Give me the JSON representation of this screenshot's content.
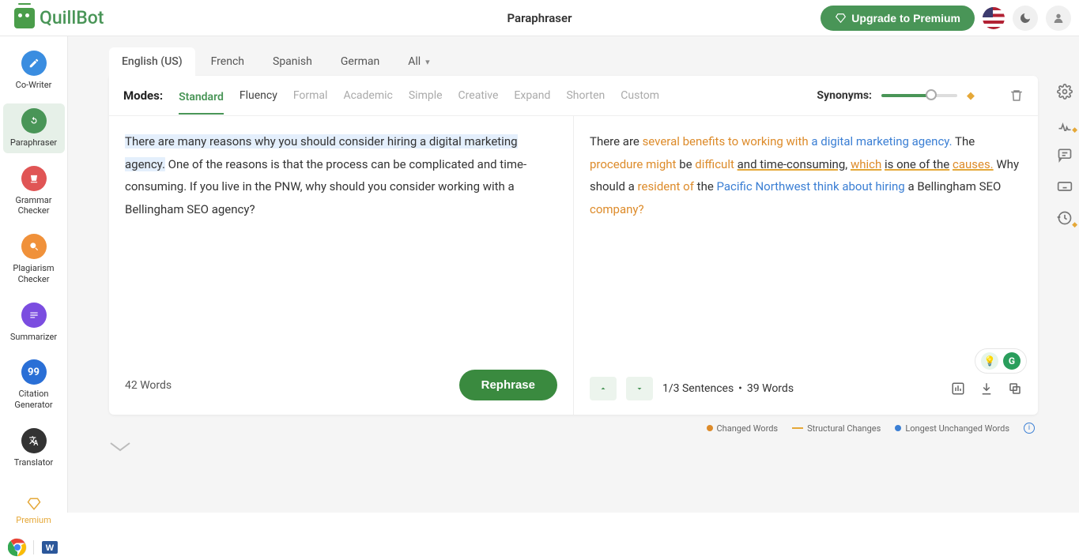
{
  "brand": "QuillBot",
  "header": {
    "title": "Paraphraser",
    "premium_button": "Upgrade to Premium"
  },
  "sidebar": {
    "items": [
      {
        "label": "Co-Writer",
        "icon": "pen-icon",
        "color": "#3a8de0"
      },
      {
        "label": "Paraphraser",
        "icon": "paraphraser-icon",
        "color": "#499557"
      },
      {
        "label": "Grammar Checker",
        "icon": "grammar-icon",
        "color": "#e05555"
      },
      {
        "label": "Plagiarism Checker",
        "icon": "plagiarism-icon",
        "color": "#f0913a"
      },
      {
        "label": "Summarizer",
        "icon": "summarizer-icon",
        "color": "#7b4de0"
      },
      {
        "label": "Citation Generator",
        "icon": "citation-icon",
        "color": "#2a6fd6"
      },
      {
        "label": "Translator",
        "icon": "translator-icon",
        "color": "#333333"
      }
    ],
    "premium_label": "Premium"
  },
  "languages": {
    "items": [
      "English (US)",
      "French",
      "Spanish",
      "German",
      "All"
    ],
    "active": "English (US)"
  },
  "modes": {
    "label": "Modes:",
    "items": [
      {
        "name": "Standard",
        "available": true,
        "selected": true
      },
      {
        "name": "Fluency",
        "available": true,
        "selected": false
      },
      {
        "name": "Formal",
        "available": false,
        "selected": false
      },
      {
        "name": "Academic",
        "available": false,
        "selected": false
      },
      {
        "name": "Simple",
        "available": false,
        "selected": false
      },
      {
        "name": "Creative",
        "available": false,
        "selected": false
      },
      {
        "name": "Expand",
        "available": false,
        "selected": false
      },
      {
        "name": "Shorten",
        "available": false,
        "selected": false
      },
      {
        "name": "Custom",
        "available": false,
        "selected": false
      }
    ],
    "synonyms_label": "Synonyms:"
  },
  "input": {
    "highlighted": "There are many reasons why you should consider hiring a digital marketing agency.",
    "rest": " One of the reasons is that the process can be complicated and time-consuming. If you live in the PNW, why should you consider working with a Bellingham SEO agency?",
    "word_count": "42 Words",
    "rephrase_button": "Rephrase"
  },
  "output": {
    "segments": [
      {
        "t": "There are ",
        "c": ""
      },
      {
        "t": "several benefits to working with",
        "c": "o"
      },
      {
        "t": " ",
        "c": ""
      },
      {
        "t": "a digital marketing agency.",
        "c": "b"
      },
      {
        "t": " The ",
        "c": ""
      },
      {
        "t": "procedure might",
        "c": "o"
      },
      {
        "t": " be ",
        "c": ""
      },
      {
        "t": "difficult",
        "c": "o"
      },
      {
        "t": " ",
        "c": ""
      },
      {
        "t": "and time-consuming,",
        "c": "nu"
      },
      {
        "t": " ",
        "c": ""
      },
      {
        "t": "which",
        "c": "ou"
      },
      {
        "t": " ",
        "c": ""
      },
      {
        "t": "is one of the",
        "c": "nu"
      },
      {
        "t": " ",
        "c": ""
      },
      {
        "t": "causes.",
        "c": "ou"
      },
      {
        "t": " Why should a ",
        "c": ""
      },
      {
        "t": "resident of",
        "c": "o"
      },
      {
        "t": " the ",
        "c": ""
      },
      {
        "t": "Pacific Northwest think about hiring",
        "c": "b"
      },
      {
        "t": " a Bellingham SEO ",
        "c": ""
      },
      {
        "t": "company?",
        "c": "o"
      }
    ],
    "sentence_info": "1/3 Sentences",
    "word_count": "39 Words"
  },
  "legend": {
    "changed": "Changed Words",
    "structural": "Structural Changes",
    "longest": "Longest Unchanged Words"
  }
}
